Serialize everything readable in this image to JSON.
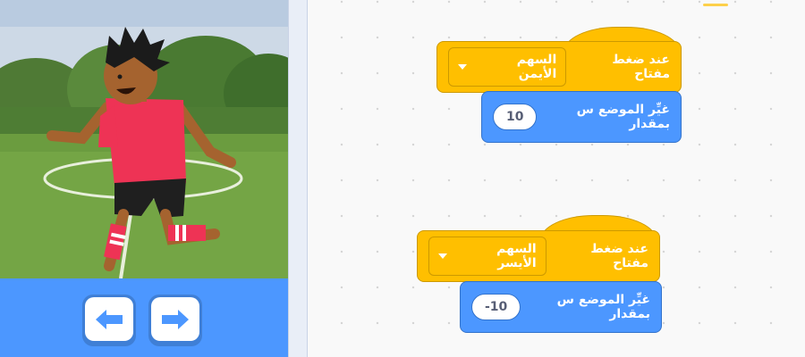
{
  "colors": {
    "event_yellow": "#ffbf00",
    "motion_blue": "#4c97ff",
    "controls_blue": "#4c97ff"
  },
  "controls": {
    "left_icon": "left-arrow-icon",
    "right_icon": "right-arrow-icon"
  },
  "scripts": [
    {
      "hat_label": "عند ضغط مفتاح",
      "key": "السهم الأيمن",
      "motion_label": "غيِّر الموضع س بمقدار",
      "value": "10"
    },
    {
      "hat_label": "عند ضغط مفتاح",
      "key": "السهم الأيسر",
      "motion_label": "غيِّر الموضع س بمقدار",
      "value": "-10"
    }
  ]
}
